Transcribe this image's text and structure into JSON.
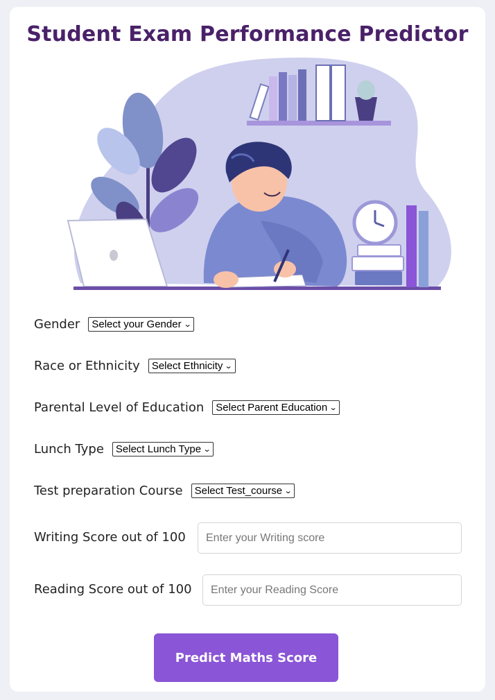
{
  "page": {
    "title": "Student Exam Performance Predictor"
  },
  "form": {
    "gender": {
      "label": "Gender",
      "selected": "Select your Gender"
    },
    "ethnicity": {
      "label": "Race or Ethnicity",
      "selected": "Select Ethnicity"
    },
    "parent_education": {
      "label": "Parental Level of Education",
      "selected": "Select Parent Education"
    },
    "lunch": {
      "label": "Lunch Type",
      "selected": "Select Lunch Type"
    },
    "test_prep": {
      "label": "Test preparation Course",
      "selected": "Select Test_course"
    },
    "writing": {
      "label": "Writing Score out of 100",
      "value": "",
      "placeholder": "Enter your Writing score"
    },
    "reading": {
      "label": "Reading Score out of 100",
      "value": "",
      "placeholder": "Enter your Reading Score"
    }
  },
  "submit": {
    "label": "Predict Maths Score"
  },
  "colors": {
    "title": "#4a2169",
    "accent": "#8a55d6",
    "illustration": "#cfd0ee"
  },
  "icons": {
    "chevron": "chevron-down-icon"
  }
}
